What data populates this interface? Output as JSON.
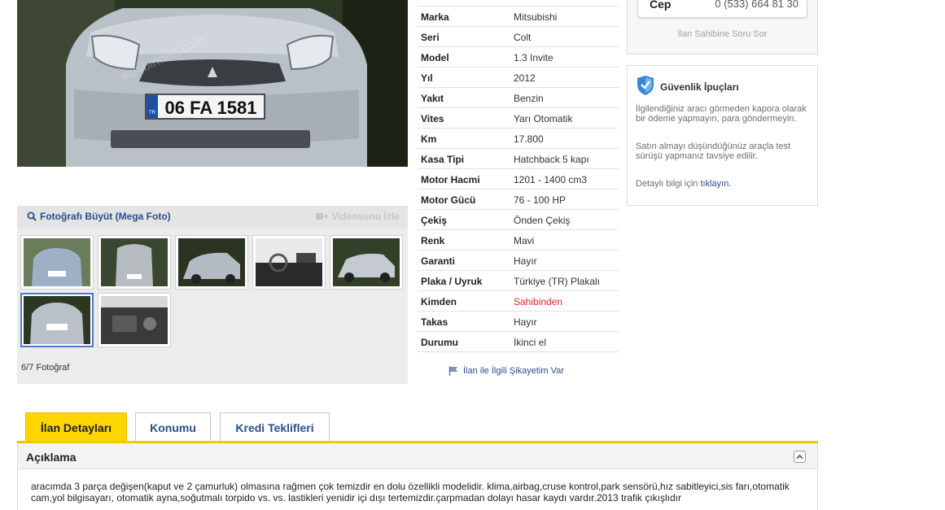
{
  "photo": {
    "plate": "06 FA 1581",
    "plate_country": "TR",
    "watermark": "sahibinden.com",
    "enlarge_label": "Fotoğrafı Büyüt (Mega Foto)",
    "video_label": "Videosunu İzle",
    "count_label": "6/7 Fotoğraf",
    "active_thumbnail": 6,
    "thumbnail_count": 7
  },
  "specs": [
    {
      "key": "Marka",
      "value": "Mitsubishi"
    },
    {
      "key": "Seri",
      "value": "Colt"
    },
    {
      "key": "Model",
      "value": "1.3 Invite"
    },
    {
      "key": "Yıl",
      "value": "2012"
    },
    {
      "key": "Yakıt",
      "value": "Benzin"
    },
    {
      "key": "Vites",
      "value": "Yarı Otomatik"
    },
    {
      "key": "Km",
      "value": "17.800"
    },
    {
      "key": "Kasa Tipi",
      "value": "Hatchback 5 kapı"
    },
    {
      "key": "Motor Hacmi",
      "value": "1201 - 1400 cm3"
    },
    {
      "key": "Motor Gücü",
      "value": "76 - 100 HP"
    },
    {
      "key": "Çekiş",
      "value": "Önden Çekiş"
    },
    {
      "key": "Renk",
      "value": "Mavi"
    },
    {
      "key": "Garanti",
      "value": "Hayır"
    },
    {
      "key": "Plaka / Uyruk",
      "value": "Türkiye (TR) Plakalı"
    },
    {
      "key": "Kimden",
      "value": "Sahibinden"
    },
    {
      "key": "Takas",
      "value": "Hayır"
    },
    {
      "key": "Durumu",
      "value": "İkinci el"
    }
  ],
  "report_label": "İlan ile İlgili Şikayetim Var",
  "contact": {
    "phone_label": "Cep",
    "phone_number": "0 (533) 664 81 30",
    "ask_label": "İlan Sahibine Soru Sor"
  },
  "safety": {
    "title": "Güvenlik İpuçları",
    "tip1": "İlgilendiğiniz aracı görmeden kapora olarak bir ödeme yapmayın, para göndermeyin.",
    "tip2": "Satın almayı düşündüğünüz araçla test sürüşü yapmanız tavsiye edilir.",
    "more_prefix": "Detaylı bilgi için ",
    "more_link": "tıklayın."
  },
  "tabs": [
    {
      "label": "İlan Detayları"
    },
    {
      "label": "Konumu"
    },
    {
      "label": "Kredi Teklifleri"
    }
  ],
  "description": {
    "title": "Açıklama",
    "text": "aracımda 3 parça değişen(kaput ve 2 çamurluk) olmasına rağmen çok temizdir en dolu özellikli modelidir. klima,airbag,cruse kontrol,park sensörü,hız sabitleyici,sis farı,otomatik cam,yol bilgisayarı, otomatik ayna,soğutmalı torpido vs. vs. lastikleri yenidir içi dışı tertemizdir.çarpmadan dolayı hasar kaydı vardır.2013 trafik çıkışlıdır"
  },
  "colors": {
    "accent": "#fdd600",
    "link": "#274f8b",
    "highlight_red": "#d9262c"
  },
  "icons": [
    "search-icon",
    "video-camera-icon",
    "flag-icon",
    "shield-icon",
    "collapse-icon"
  ]
}
